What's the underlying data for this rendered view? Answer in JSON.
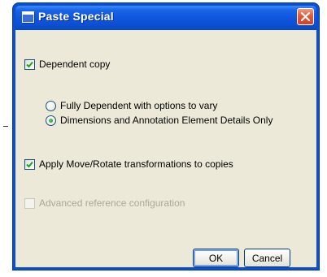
{
  "dialog": {
    "title": "Paste Special",
    "dependent_copy": {
      "label": "Dependent copy",
      "checked": true
    },
    "radio_options": [
      {
        "label": "Fully Dependent with options to vary",
        "selected": false
      },
      {
        "label": "Dimensions and Annotation Element Details Only",
        "selected": true
      }
    ],
    "apply_transformations": {
      "label": "Apply Move/Rotate transformations to copies",
      "checked": true
    },
    "advanced_reference": {
      "label": "Advanced reference configuration",
      "checked": false,
      "enabled": false
    },
    "ok_label": "OK",
    "cancel_label": "Cancel"
  },
  "colors": {
    "titlebar": "#0a56d8",
    "client": "#ece9d8",
    "close_button": "#e2593a",
    "radio_dot": "#2f9a2c",
    "check_mark": "#21a121"
  },
  "icons": [
    "window-icon",
    "close-icon",
    "checkmark-icon"
  ]
}
